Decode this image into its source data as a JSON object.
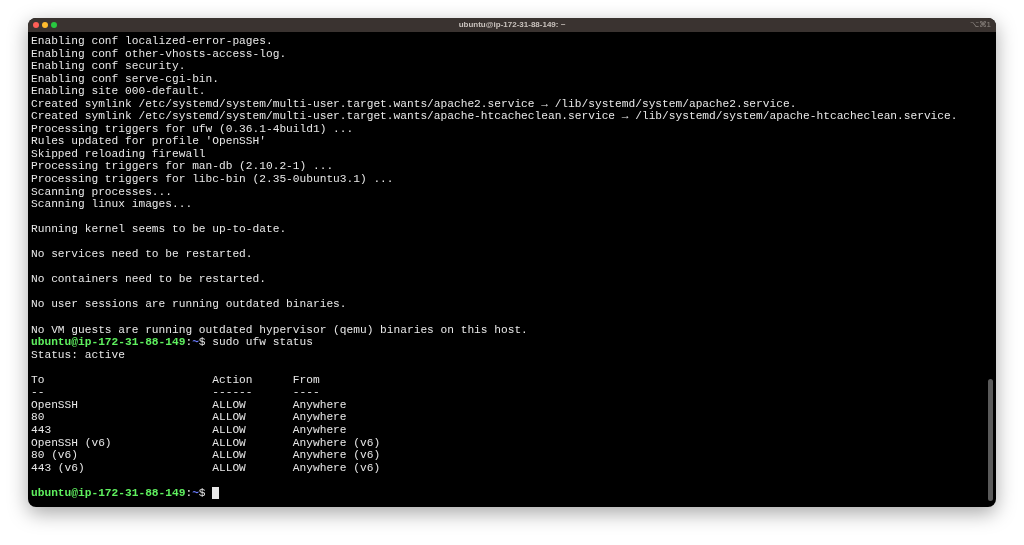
{
  "window": {
    "title": "ubuntu@ip-172-31-88-149: ~",
    "shortcut": "⌥⌘1"
  },
  "lines": [
    {
      "kind": "text",
      "text": "Enabling conf localized-error-pages."
    },
    {
      "kind": "text",
      "text": "Enabling conf other-vhosts-access-log."
    },
    {
      "kind": "text",
      "text": "Enabling conf security."
    },
    {
      "kind": "text",
      "text": "Enabling conf serve-cgi-bin."
    },
    {
      "kind": "text",
      "text": "Enabling site 000-default."
    },
    {
      "kind": "text",
      "text": "Created symlink /etc/systemd/system/multi-user.target.wants/apache2.service → /lib/systemd/system/apache2.service."
    },
    {
      "kind": "text",
      "text": "Created symlink /etc/systemd/system/multi-user.target.wants/apache-htcacheclean.service → /lib/systemd/system/apache-htcacheclean.service."
    },
    {
      "kind": "text",
      "text": "Processing triggers for ufw (0.36.1-4build1) ..."
    },
    {
      "kind": "text",
      "text": "Rules updated for profile 'OpenSSH'"
    },
    {
      "kind": "text",
      "text": "Skipped reloading firewall"
    },
    {
      "kind": "text",
      "text": "Processing triggers for man-db (2.10.2-1) ..."
    },
    {
      "kind": "text",
      "text": "Processing triggers for libc-bin (2.35-0ubuntu3.1) ..."
    },
    {
      "kind": "text",
      "text": "Scanning processes..."
    },
    {
      "kind": "text",
      "text": "Scanning linux images..."
    },
    {
      "kind": "blank"
    },
    {
      "kind": "text",
      "text": "Running kernel seems to be up-to-date."
    },
    {
      "kind": "blank"
    },
    {
      "kind": "text",
      "text": "No services need to be restarted."
    },
    {
      "kind": "blank"
    },
    {
      "kind": "text",
      "text": "No containers need to be restarted."
    },
    {
      "kind": "blank"
    },
    {
      "kind": "text",
      "text": "No user sessions are running outdated binaries."
    },
    {
      "kind": "blank"
    },
    {
      "kind": "text",
      "text": "No VM guests are running outdated hypervisor (qemu) binaries on this host."
    },
    {
      "kind": "prompt",
      "user_host": "ubuntu@ip-172-31-88-149",
      "separator": ":",
      "path": "~",
      "symbol": "$",
      "command": "sudo ufw status",
      "cursor": false
    },
    {
      "kind": "text",
      "text": "Status: active"
    },
    {
      "kind": "blank"
    },
    {
      "kind": "text",
      "text": "To                         Action      From"
    },
    {
      "kind": "text",
      "text": "--                         ------      ----"
    },
    {
      "kind": "text",
      "text": "OpenSSH                    ALLOW       Anywhere"
    },
    {
      "kind": "text",
      "text": "80                         ALLOW       Anywhere"
    },
    {
      "kind": "text",
      "text": "443                        ALLOW       Anywhere"
    },
    {
      "kind": "text",
      "text": "OpenSSH (v6)               ALLOW       Anywhere (v6)"
    },
    {
      "kind": "text",
      "text": "80 (v6)                    ALLOW       Anywhere (v6)"
    },
    {
      "kind": "text",
      "text": "443 (v6)                   ALLOW       Anywhere (v6)"
    },
    {
      "kind": "blank"
    },
    {
      "kind": "prompt",
      "user_host": "ubuntu@ip-172-31-88-149",
      "separator": ":",
      "path": "~",
      "symbol": "$",
      "cursor": true
    }
  ]
}
